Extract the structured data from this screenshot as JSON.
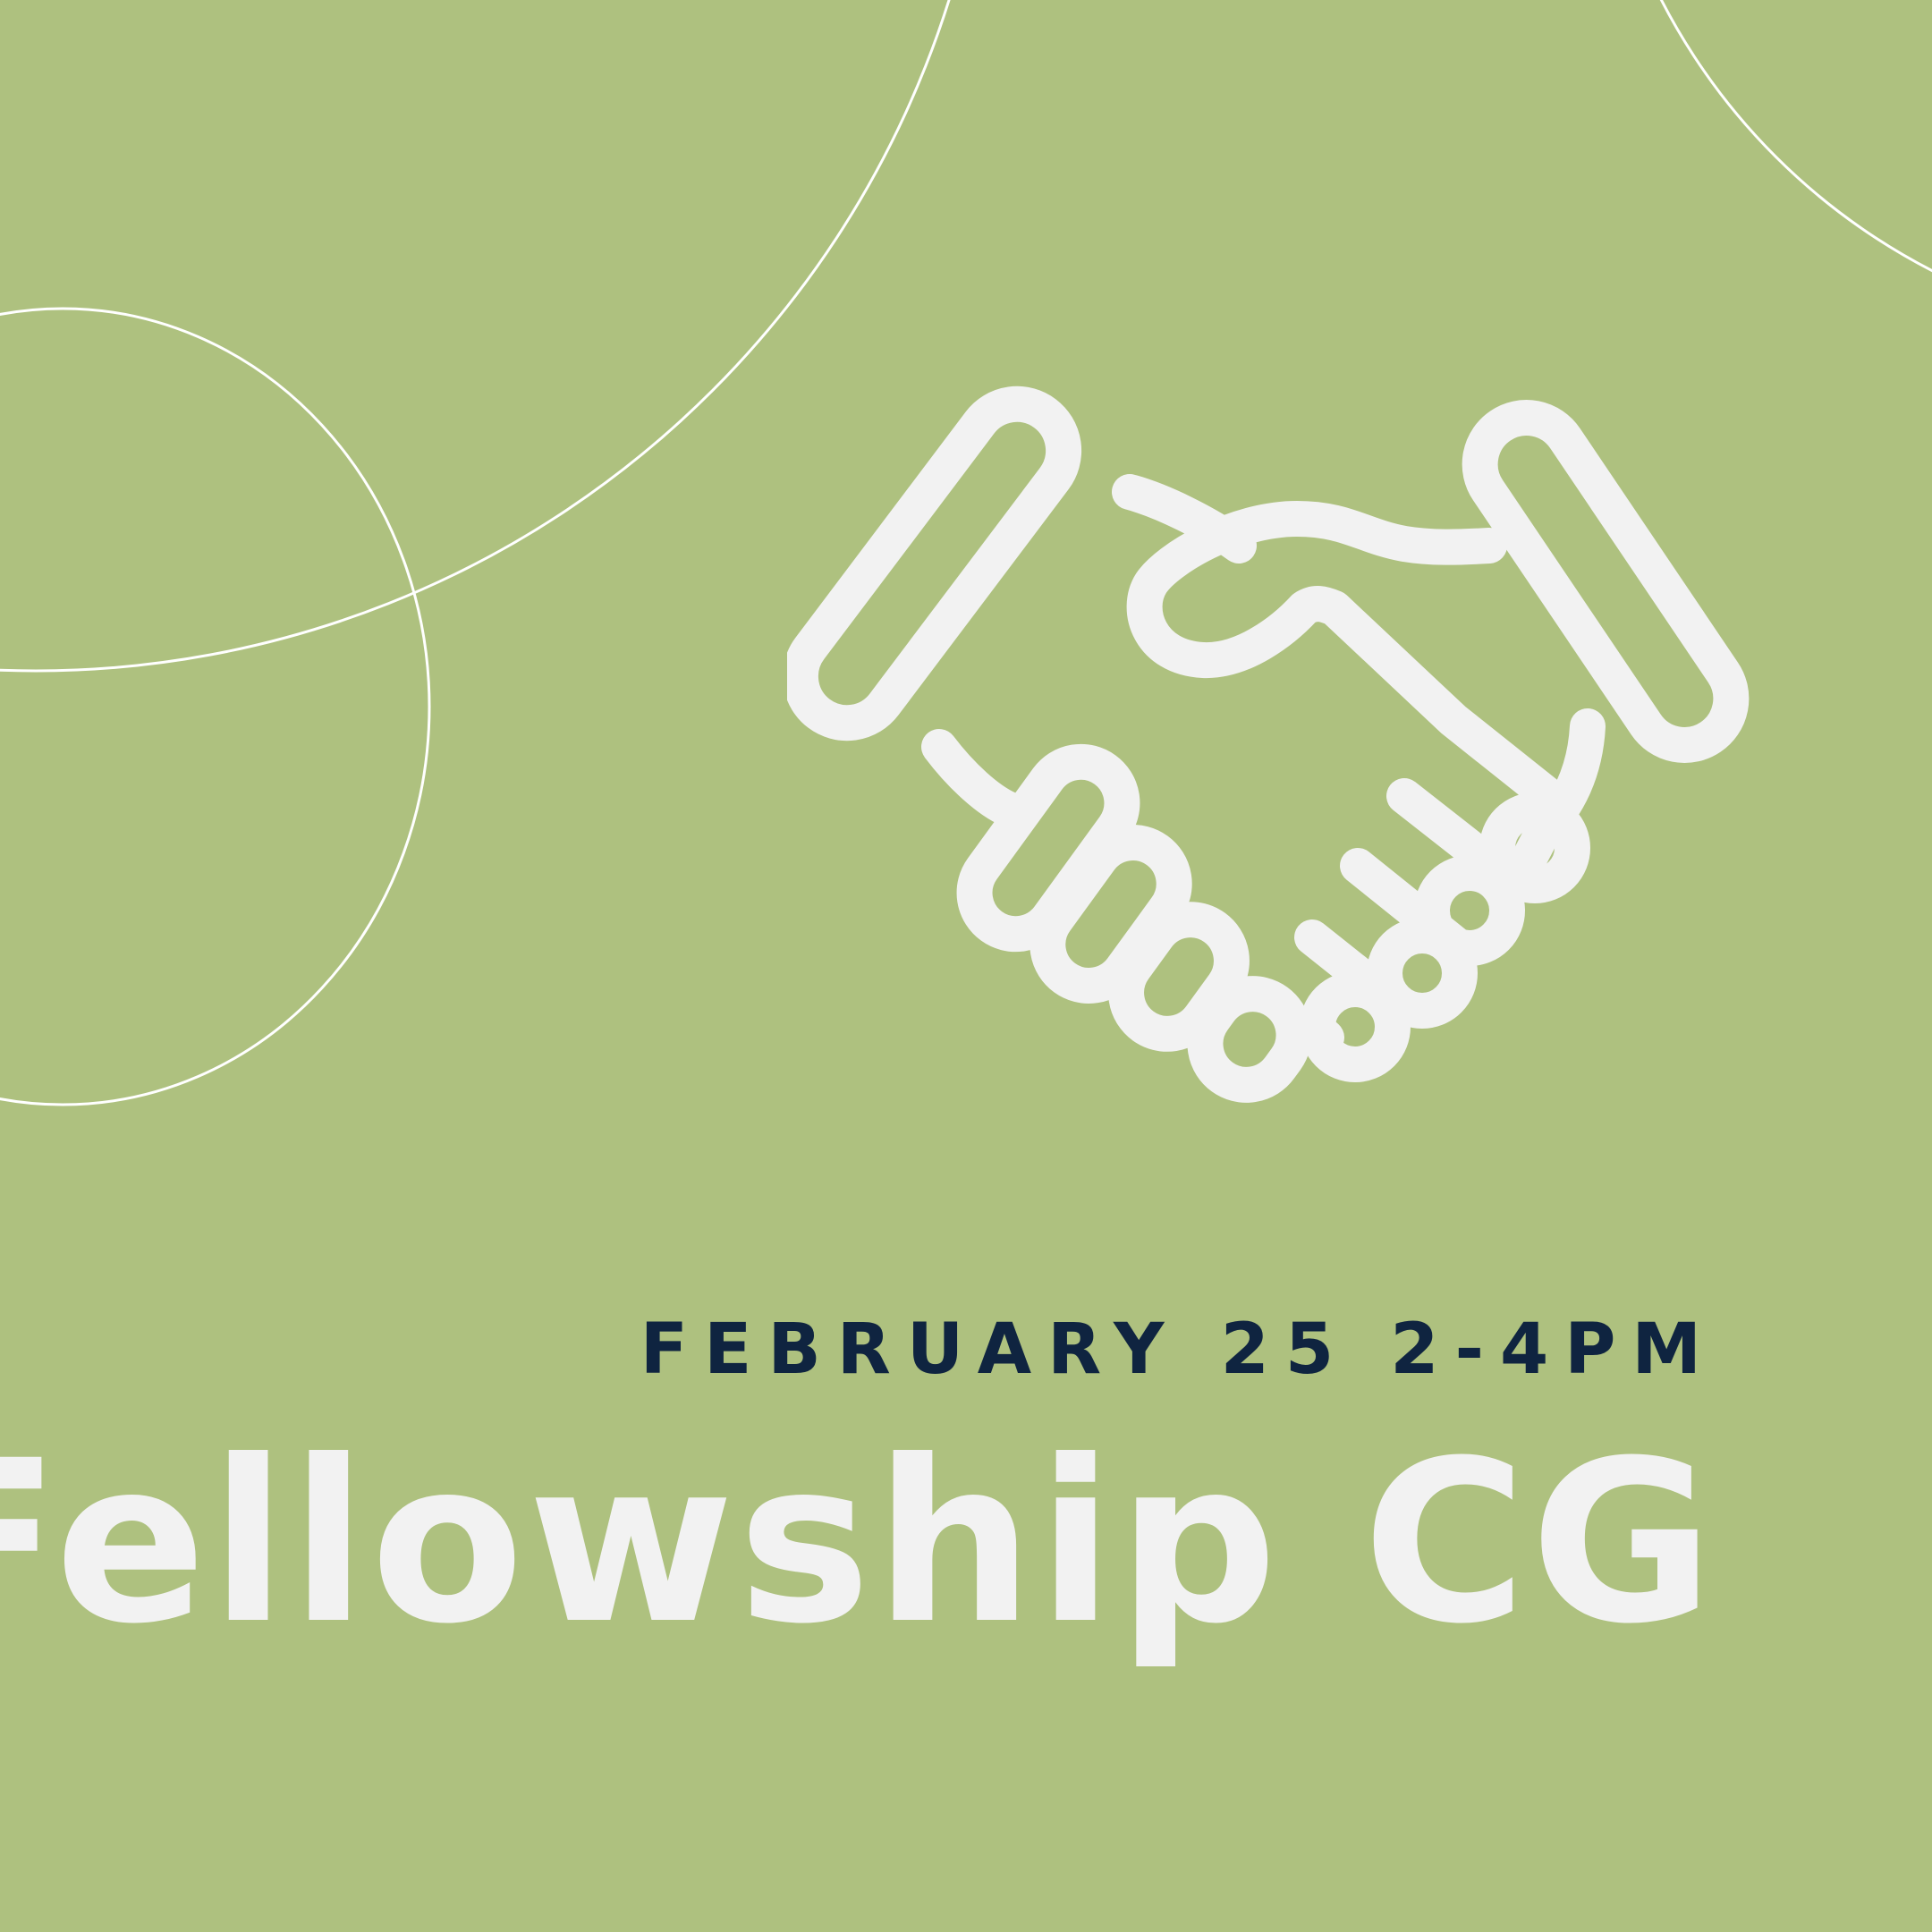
{
  "poster": {
    "date_time": "FEBRUARY 25 2-4PM",
    "title": "Fellowship CG",
    "icon": "handshake-icon"
  },
  "colors": {
    "background": "#aec17f",
    "icon": "#f2f2f2",
    "title": "#f2f2f2",
    "date": "#0f2440",
    "decorative_lines": "#ffffff"
  }
}
